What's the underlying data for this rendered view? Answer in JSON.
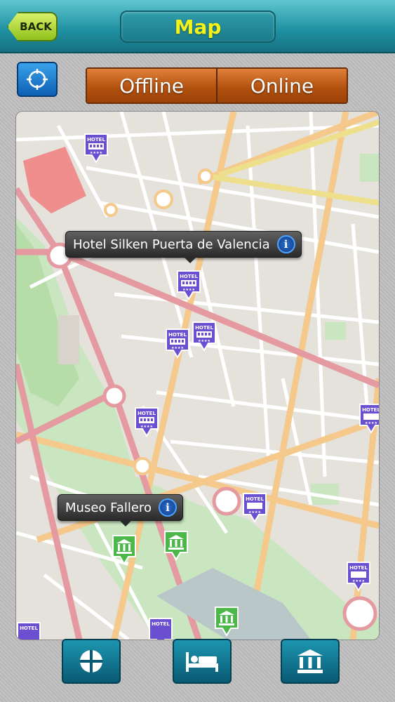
{
  "header": {
    "back_label": "BACK",
    "title": "Map"
  },
  "segmented": {
    "offline_label": "Offline",
    "online_label": "Online"
  },
  "map": {
    "callouts": [
      {
        "label": "Hotel Silken Puerta de Valencia",
        "info": "i"
      },
      {
        "label": "Museo Fallero",
        "info": "i"
      }
    ],
    "pin_text": "HOTEL"
  },
  "icons": {
    "locate": "crosshair-icon",
    "filter_all": "compass-icon",
    "filter_hotels": "bed-icon",
    "filter_museums": "museum-icon"
  },
  "colors": {
    "accent": "#1e8fa0",
    "title": "#f3f21a",
    "segment": "#b4520f",
    "hotel_pin": "#6a4fd1",
    "museum_pin": "#4cb84a"
  }
}
